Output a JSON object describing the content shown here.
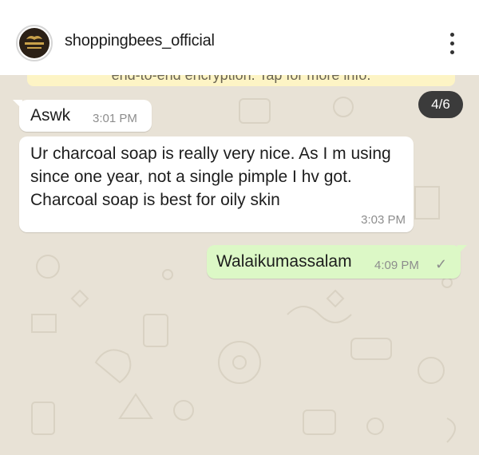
{
  "header": {
    "account_name": "shoppingbees_official",
    "avatar_logo_text": "Shopping Bees",
    "avatar_logo_subtext": "Beauty Boutique"
  },
  "chat": {
    "encryption_notice": "end-to-end encryption. Tap for more info.",
    "image_counter": "4/6",
    "messages": [
      {
        "direction": "incoming",
        "text": "Aswk",
        "time": "3:01 PM"
      },
      {
        "direction": "incoming",
        "text": "Ur charcoal soap is really very nice. As I m using since one year, not a single pimple I hv got. Charcoal soap is best for oily skin",
        "time": "3:03 PM"
      },
      {
        "direction": "outgoing",
        "text": "Walaikumassalam",
        "time": "4:09 PM",
        "status_icon": "check-icon"
      }
    ]
  },
  "colors": {
    "wallpaper": "#e8e2d6",
    "incoming_bubble": "#ffffff",
    "outgoing_bubble": "#dcf8c6",
    "banner": "#fdf4c5",
    "counter_bg": "#3b3b3b"
  }
}
